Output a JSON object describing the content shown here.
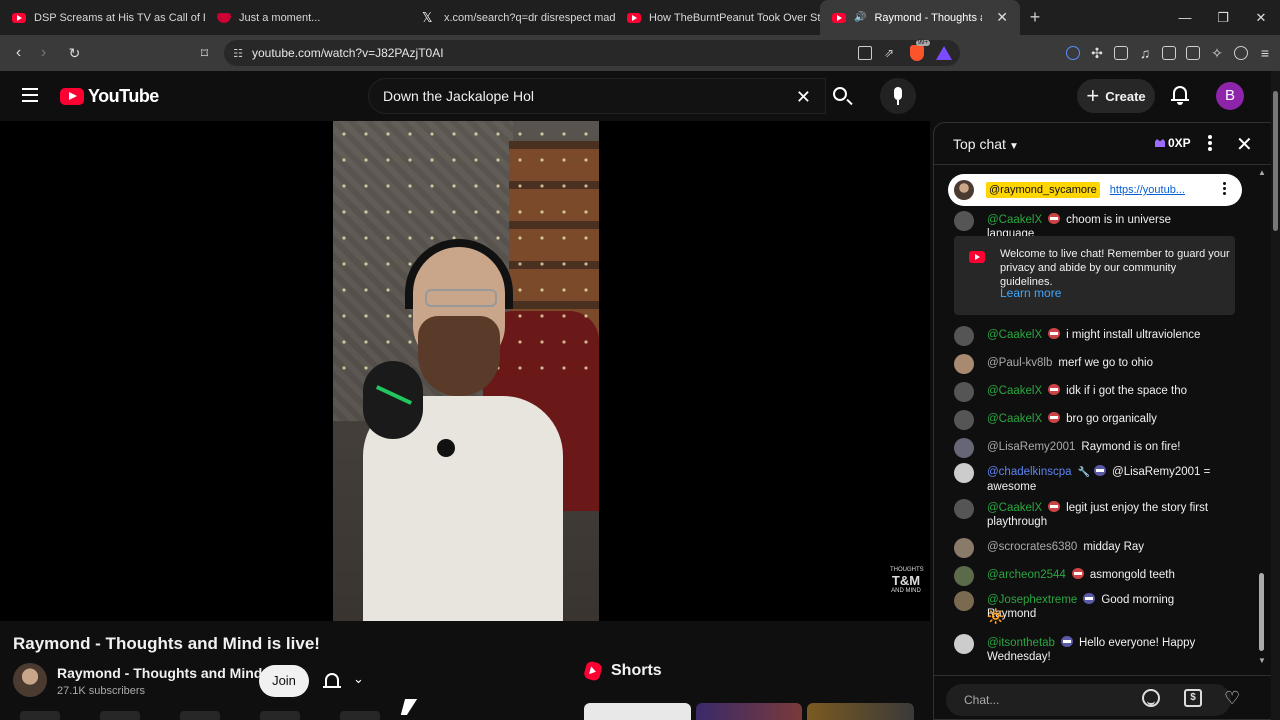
{
  "browser": {
    "tabs": [
      {
        "label": "DSP Screams at His TV as Call of Duty",
        "favicon": "youtube-icon"
      },
      {
        "label": "Just a moment...",
        "favicon": "shield-icon"
      },
      {
        "label": "x.com/search?q=dr disrespect madur",
        "favicon": "x-icon"
      },
      {
        "label": "How TheBurntPeanut Took Over Strea",
        "favicon": "youtube-icon"
      },
      {
        "label": "Raymond - Thoughts and Mind is live!",
        "favicon": "youtube-icon",
        "active": true
      }
    ],
    "new_tab": "+",
    "url": "youtube.com/watch?v=J82PAzjT0AI",
    "brave_badge": "99+"
  },
  "youtube": {
    "logo_text": "YouTube",
    "search": {
      "value": "Down the Jackalope Hol",
      "clear": "✕"
    },
    "create_label": "Create",
    "account_initial": "B",
    "video": {
      "title": "Raymond - Thoughts and Mind is live!",
      "watermark_top": "THOUGHTS",
      "watermark_big": "T&M",
      "watermark_bottom": "AND MIND"
    },
    "channel": {
      "name": "Raymond - Thoughts and Mind",
      "subscribers": "27.1K subscribers",
      "join_label": "Join"
    },
    "shorts_title": "Shorts"
  },
  "chat": {
    "mode_label": "Top chat",
    "xp_label": "0XP",
    "pinned": {
      "author": "@raymond_sycamore",
      "link": "https://youtub..."
    },
    "messages_top": [
      {
        "author": "@CaakelX",
        "text": "choom is in universe language",
        "style": "member",
        "badge": "red"
      }
    ],
    "welcome": {
      "text": "Welcome to live chat! Remember to guard your privacy and abide by our community guidelines.",
      "link": "Learn more"
    },
    "messages": [
      {
        "author": "@CaakelX",
        "text": "i might install ultraviolence",
        "style": "member",
        "badge": "red"
      },
      {
        "author": "@Paul-kv8lb",
        "text": "merf we go to ohio",
        "style": "plain",
        "badge": ""
      },
      {
        "author": "@CaakelX",
        "text": "idk if i got the space tho",
        "style": "member",
        "badge": "red"
      },
      {
        "author": "@CaakelX",
        "text": "bro go organically",
        "style": "member",
        "badge": "red"
      },
      {
        "author": "@LisaRemy2001",
        "text": "Raymond is on fire!",
        "style": "plain",
        "badge": ""
      },
      {
        "author": "@chadelkinscpa",
        "text": "@LisaRemy2001 = awesome",
        "style": "mod",
        "badge": "blue"
      },
      {
        "author": "@CaakelX",
        "text": "legit just enjoy the story first playthrough",
        "style": "member",
        "badge": "red"
      },
      {
        "author": "@scrocrates6380",
        "text": "midday Ray",
        "style": "plain",
        "badge": ""
      },
      {
        "author": "@archeon2544",
        "text": "asmongold teeth",
        "style": "member",
        "badge": "red"
      },
      {
        "author": "@Josephextreme",
        "text": "Good morning Raymond",
        "style": "member",
        "badge": "blue"
      },
      {
        "author": "@itsonthetab",
        "text": "Hello everyone! Happy Wednesday!",
        "style": "member",
        "badge": "blue"
      }
    ],
    "input_placeholder": "Chat...",
    "sun_emoji": "🔆"
  }
}
